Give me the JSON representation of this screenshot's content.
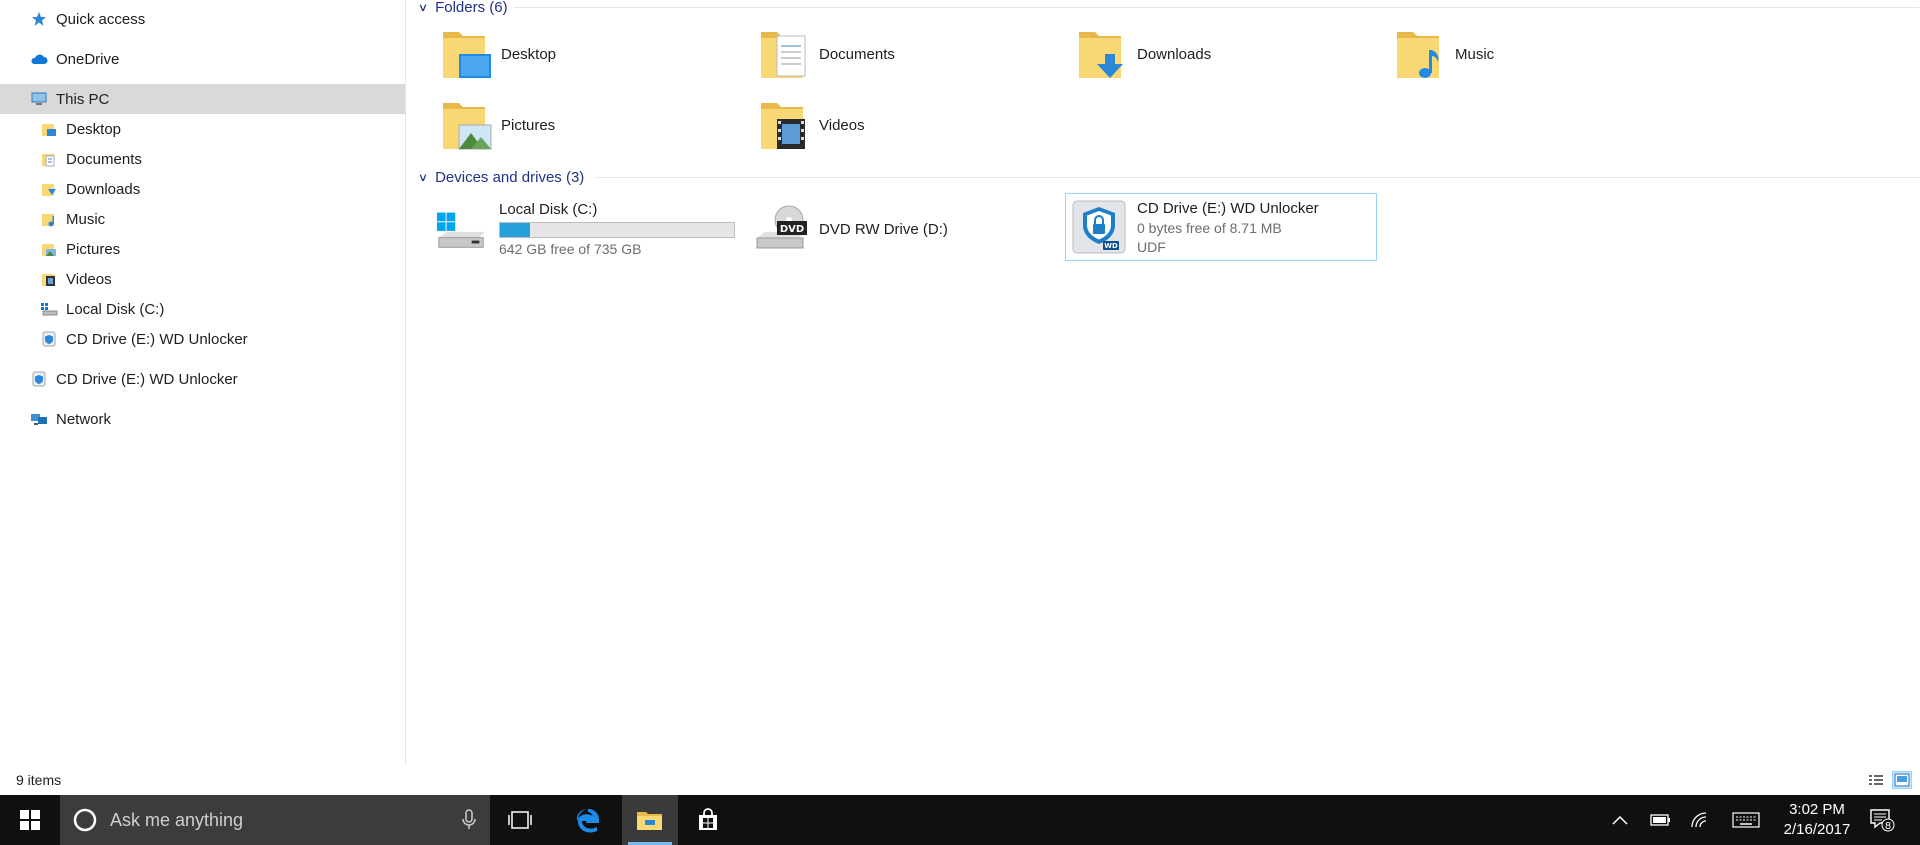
{
  "nav": {
    "items": [
      {
        "label": "Quick access",
        "icon": "star-icon"
      },
      {
        "label": "OneDrive",
        "icon": "cloud-icon"
      },
      {
        "label": "This PC",
        "icon": "computer-icon"
      },
      {
        "label": "Desktop",
        "icon": "desktop-folder-icon"
      },
      {
        "label": "Documents",
        "icon": "documents-folder-icon"
      },
      {
        "label": "Downloads",
        "icon": "downloads-folder-icon"
      },
      {
        "label": "Music",
        "icon": "music-folder-icon"
      },
      {
        "label": "Pictures",
        "icon": "pictures-folder-icon"
      },
      {
        "label": "Videos",
        "icon": "videos-folder-icon"
      },
      {
        "label": "Local Disk (C:)",
        "icon": "local-disk-icon"
      },
      {
        "label": "CD Drive (E:) WD Unlocker",
        "icon": "cd-drive-icon"
      },
      {
        "label": "CD Drive (E:) WD Unlocker",
        "icon": "cd-drive-icon"
      },
      {
        "label": "Network",
        "icon": "network-icon"
      }
    ],
    "selected": "This PC"
  },
  "folders": {
    "header": "Folders (6)",
    "items": [
      {
        "label": "Desktop"
      },
      {
        "label": "Documents"
      },
      {
        "label": "Downloads"
      },
      {
        "label": "Music"
      },
      {
        "label": "Pictures"
      },
      {
        "label": "Videos"
      }
    ]
  },
  "drives": {
    "header": "Devices and drives (3)",
    "items": [
      {
        "name": "Local Disk (C:)",
        "free": "642 GB free of 735 GB",
        "used_fraction": 0.13
      },
      {
        "name": "DVD RW Drive (D:)"
      },
      {
        "name": "CD Drive (E:) WD Unlocker",
        "free": "0 bytes free of 8.71 MB",
        "fs": "UDF"
      }
    ]
  },
  "dvd_badge": "DVD",
  "wd_badge": "WD",
  "status": {
    "count": "9 items"
  },
  "taskbar": {
    "search_placeholder": "Ask me anything",
    "time": "3:02 PM",
    "date": "2/16/2017",
    "notification_count": "8"
  },
  "colors": {
    "accent": "#26a0da",
    "header_blue": "#1e3287",
    "selection": "#99d1ff",
    "folder_yellow": "#f8d775"
  }
}
